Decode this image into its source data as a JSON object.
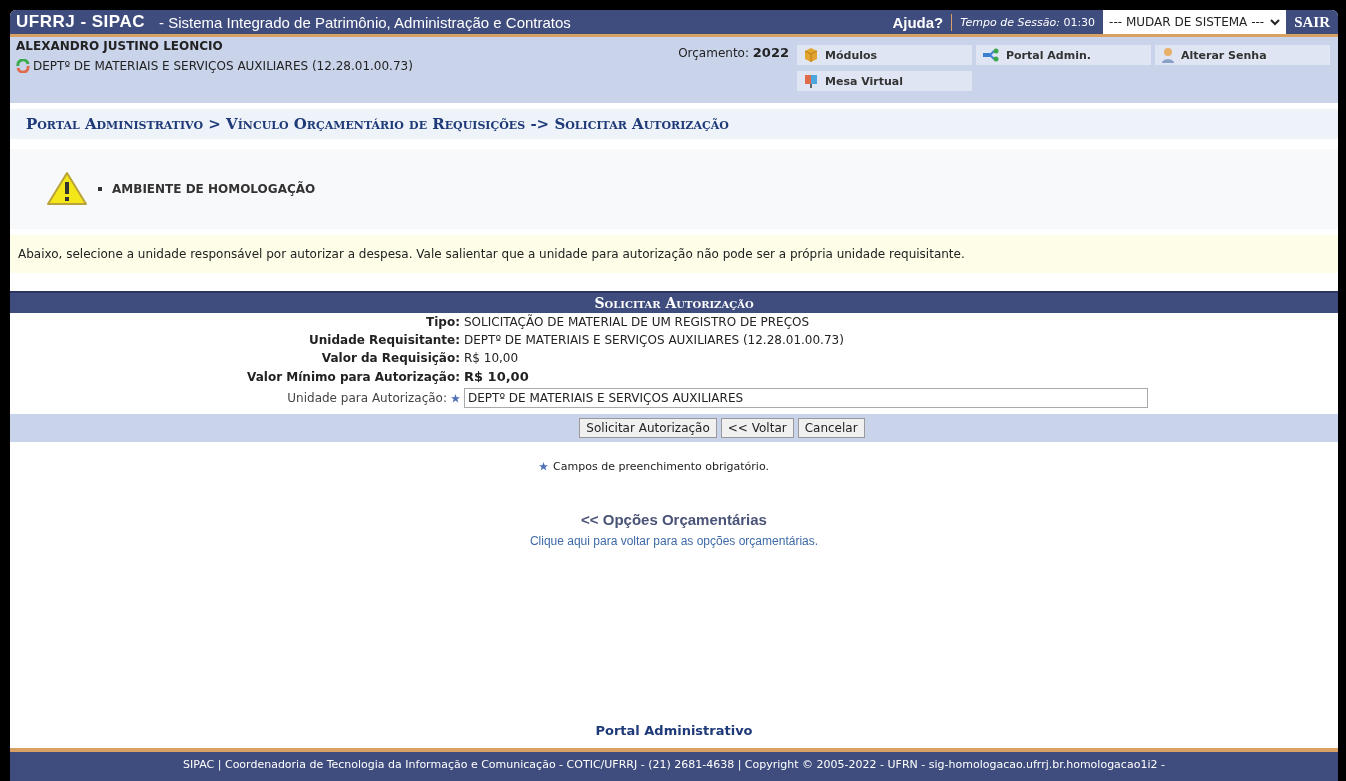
{
  "header": {
    "brand": "UFRRJ - SIPAC",
    "system_name": "- Sistema Integrado de Patrimônio, Administração e Contratos",
    "help": "Ajuda?",
    "session_label": "Tempo de Sessão:",
    "session_time": "01:30",
    "system_select": "--- MUDAR DE SISTEMA ---",
    "logout": "SAIR"
  },
  "user": {
    "name": "ALEXANDRO JUSTINO LEONCIO",
    "unit": "DEPTº DE MATERIAIS E SERVIÇOS AUXILIARES (12.28.01.00.73)",
    "budget_label": "Orçamento:",
    "budget_year": "2022"
  },
  "shortcuts": [
    {
      "kind": "modules",
      "label": "Módulos"
    },
    {
      "kind": "portal",
      "label": "Portal Admin."
    },
    {
      "kind": "password",
      "label": "Alterar Senha"
    },
    {
      "kind": "desk",
      "label": "Mesa Virtual"
    }
  ],
  "breadcrumb": "Portal Administrativo > Vínculo Orçamentário de Requisições -> Solicitar Autorização",
  "warning": "AMBIENTE DE HOMOLOGAÇÃO",
  "info": "Abaixo, selecione a unidade responsável por autorizar a despesa. Vale salientar que a unidade para autorização não pode ser a própria unidade requisitante.",
  "form": {
    "title": "Solicitar Autorização",
    "rows": [
      {
        "kind": "text",
        "label": "Tipo:",
        "value": "SOLICITAÇÃO DE MATERIAL DE UM REGISTRO DE PREÇOS"
      },
      {
        "kind": "text",
        "label": "Unidade Requisitante:",
        "value": "DEPTº DE MATERIAIS E SERVIÇOS AUXILIARES (12.28.01.00.73)"
      },
      {
        "kind": "text",
        "label": "Valor da Requisição:",
        "value": "R$ 10,00"
      },
      {
        "kind": "strong",
        "label": "Valor Mínimo para Autorização:",
        "value": "R$ 10,00"
      },
      {
        "kind": "input",
        "label": "Unidade para Autorização:",
        "value": "DEPTº DE MATERIAIS E SERVIÇOS AUXILIARES",
        "required": true
      }
    ],
    "buttons": [
      "Solicitar Autorização",
      "<< Voltar",
      "Cancelar"
    ]
  },
  "required_note": "Campos de preenchimento obrigatório.",
  "back_link": {
    "title": "<< Opções Orçamentárias",
    "description": "Clique aqui para voltar para as opções orçamentárias."
  },
  "portal_link": "Portal Administrativo",
  "footer": "SIPAC | Coordenadoria de Tecnologia da Informação e Comunicação - COTIC/UFRRJ - (21) 2681-4638 | Copyright © 2005-2022 - UFRN - sig-homologacao.ufrrj.br.homologacao1i2 -"
}
